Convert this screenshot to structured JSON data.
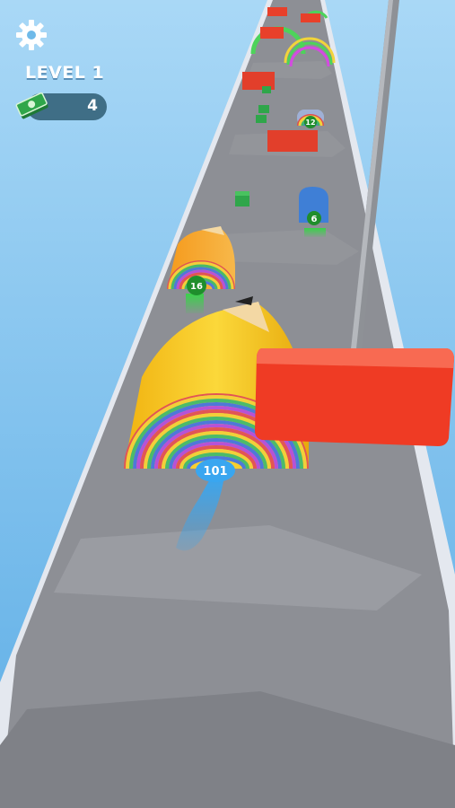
{
  "hud": {
    "level_label": "LEVEL 1",
    "money_value": "4",
    "settings_icon": "gear-icon",
    "money_icon": "cash-stack-icon"
  },
  "player_roll": {
    "count_label": "101"
  },
  "track_rolls": [
    {
      "count_label": "16",
      "color": "#f59a1c"
    },
    {
      "count_label": "12",
      "color": "#a8b4d8"
    },
    {
      "count_label": "6",
      "color": "#3f7fd6"
    }
  ],
  "colors": {
    "sky": "#7cc3ee",
    "track": "#8a8c92",
    "track_edge": "#dfe3ea",
    "hammer": "#ef3b24",
    "pencil_body": "#f4c21a",
    "badge": "#1f8e2c",
    "money_pill": "#3f6e86"
  }
}
